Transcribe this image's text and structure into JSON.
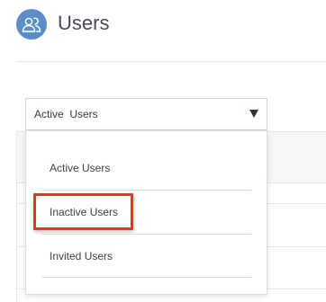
{
  "header": {
    "icon": "users-icon",
    "title": "Users",
    "icon_color": "#5b8ec6"
  },
  "filter": {
    "selected": "Active  Users",
    "arrow_icon": "triangle-down-icon"
  },
  "dropdown": {
    "options": [
      {
        "label": "Active Users"
      },
      {
        "label": "Inactive Users",
        "highlighted": true
      },
      {
        "label": "Invited Users"
      }
    ],
    "highlight_color": "#e8321f"
  }
}
